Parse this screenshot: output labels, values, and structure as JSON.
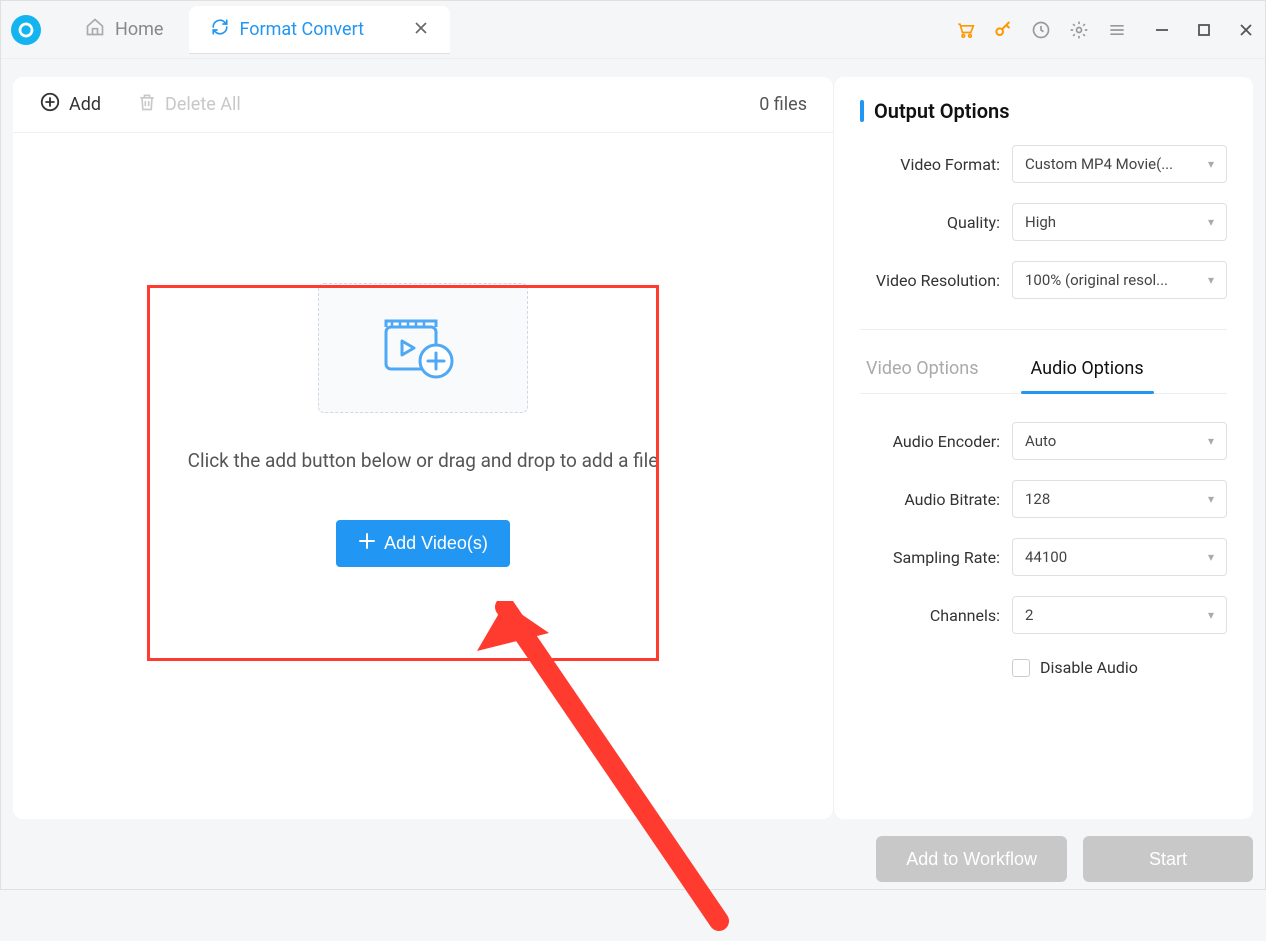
{
  "tabs": {
    "home": "Home",
    "active": "Format Convert"
  },
  "toolbar": {
    "add": "Add",
    "delete_all": "Delete All",
    "file_count": "0 files"
  },
  "drop": {
    "instruction": "Click the add button below or drag and drop to add a file",
    "button": "Add Video(s)"
  },
  "side": {
    "title": "Output Options",
    "video_format_label": "Video Format:",
    "video_format_value": "Custom MP4 Movie(...",
    "quality_label": "Quality:",
    "quality_value": "High",
    "resolution_label": "Video Resolution:",
    "resolution_value": "100% (original resol...",
    "subtab_video": "Video Options",
    "subtab_audio": "Audio Options",
    "audio_encoder_label": "Audio Encoder:",
    "audio_encoder_value": "Auto",
    "audio_bitrate_label": "Audio Bitrate:",
    "audio_bitrate_value": "128",
    "sampling_label": "Sampling Rate:",
    "sampling_value": "44100",
    "channels_label": "Channels:",
    "channels_value": "2",
    "disable_audio": "Disable Audio"
  },
  "footer": {
    "workflow": "Add to Workflow",
    "start": "Start"
  }
}
